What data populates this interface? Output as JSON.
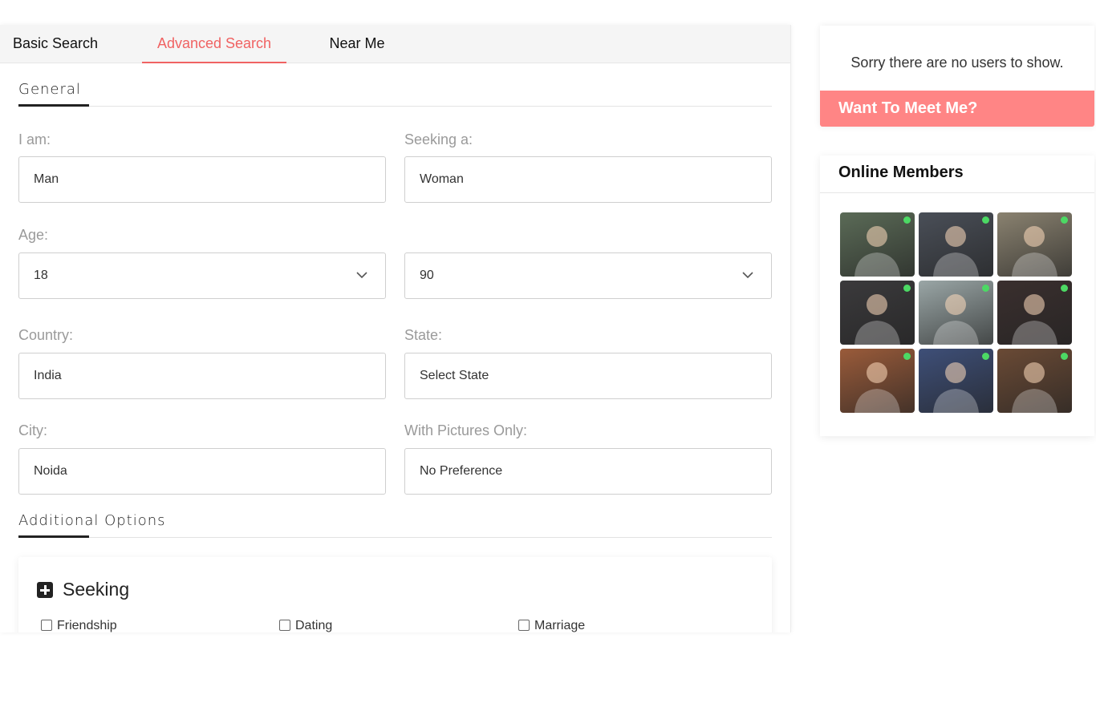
{
  "tabs": [
    {
      "label": "Basic Search"
    },
    {
      "label": "Advanced Search"
    },
    {
      "label": "Near Me"
    }
  ],
  "general": {
    "title": "General",
    "iam_label": "I am:",
    "iam_value": "Man",
    "seeking_label": "Seeking a:",
    "seeking_value": "Woman",
    "age_label": "Age:",
    "age_min": "18",
    "age_max": "90",
    "country_label": "Country:",
    "country_value": "India",
    "state_label": "State:",
    "state_value": "Select State",
    "city_label": "City:",
    "city_value": "Noida",
    "pictures_label": "With Pictures Only:",
    "pictures_value": "No Preference"
  },
  "additional": {
    "title": "Additional Options",
    "seeking_title": "Seeking",
    "options": [
      {
        "label": "Friendship"
      },
      {
        "label": "Dating"
      },
      {
        "label": "Marriage"
      }
    ]
  },
  "notice": {
    "text": "Sorry there are no users to show.",
    "button": "Want To Meet Me?"
  },
  "online": {
    "title": "Online Members",
    "members": [
      {
        "bg": "#5b6b57"
      },
      {
        "bg": "#4a4f58"
      },
      {
        "bg": "#8a8270"
      },
      {
        "bg": "#3b3a3c"
      },
      {
        "bg": "#9aa6a6"
      },
      {
        "bg": "#3a2f2e"
      },
      {
        "bg": "#9a5b3a"
      },
      {
        "bg": "#3e4f78"
      },
      {
        "bg": "#6a4a35"
      }
    ]
  },
  "colors": {
    "accent": "#f06262",
    "button": "#ff8585",
    "online_dot": "#4cd964"
  }
}
